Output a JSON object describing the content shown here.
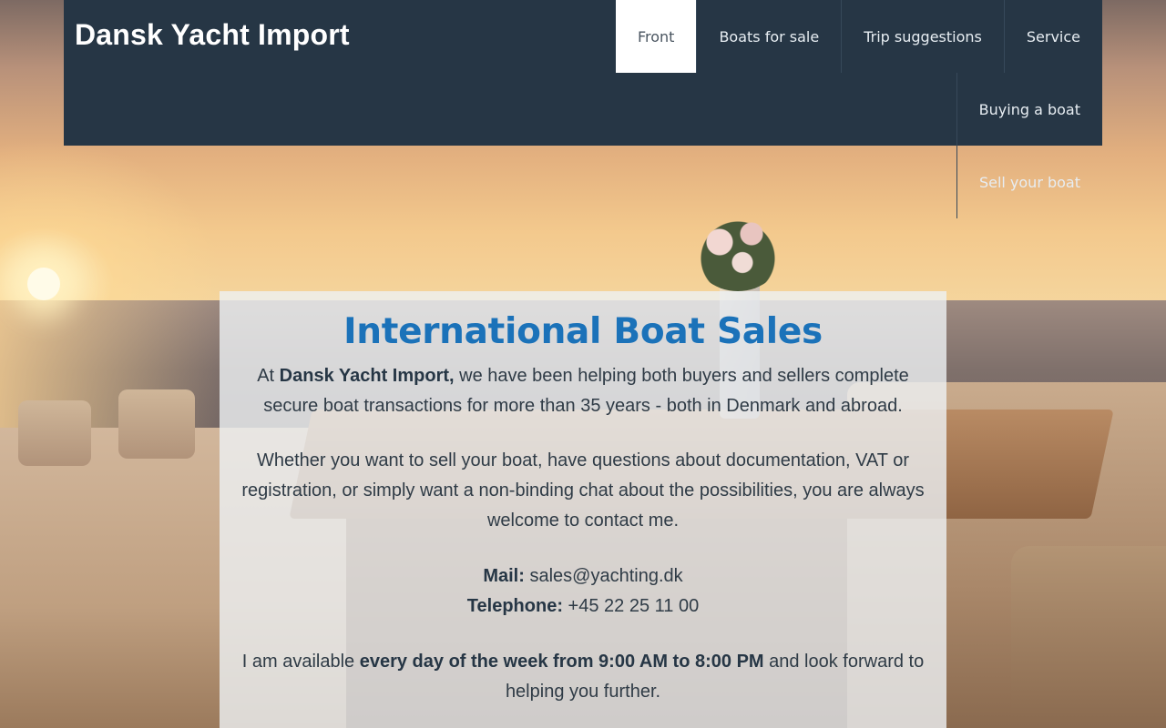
{
  "header": {
    "logo_text": "Dansk Yacht Import",
    "nav": [
      {
        "label": "Front",
        "active": true
      },
      {
        "label": "Boats for sale",
        "active": false
      },
      {
        "label": "Trip suggestions",
        "active": false
      },
      {
        "label": "Service",
        "active": false
      },
      {
        "label": "Buying a boat",
        "active": false
      },
      {
        "label": "Sell your boat",
        "active": false
      }
    ]
  },
  "main": {
    "title": "International Boat Sales",
    "intro": {
      "prefix": "At ",
      "company": "Dansk Yacht Import,",
      "rest": " we have been helping both buyers and sellers complete secure boat transactions for more than 35 years - both in Denmark and abroad."
    },
    "paragraph2": "Whether you want to sell your boat, have questions about documentation, VAT or registration, or simply want a non-binding chat about the possibilities, you are always welcome to contact me.",
    "contact": {
      "mail_label": "Mail:",
      "mail_value": "sales@yachting.dk",
      "phone_label": "Telephone:",
      "phone_value": "+45 22 25 11 00"
    },
    "availability": {
      "prefix": "I am available ",
      "bold": "every day of the week from 9:00 AM to 8:00 PM",
      "suffix": " and look forward to helping you further."
    }
  },
  "colors": {
    "header_bg": "#263645",
    "title": "#1b72b9",
    "active_nav_bg": "#ffffff"
  }
}
